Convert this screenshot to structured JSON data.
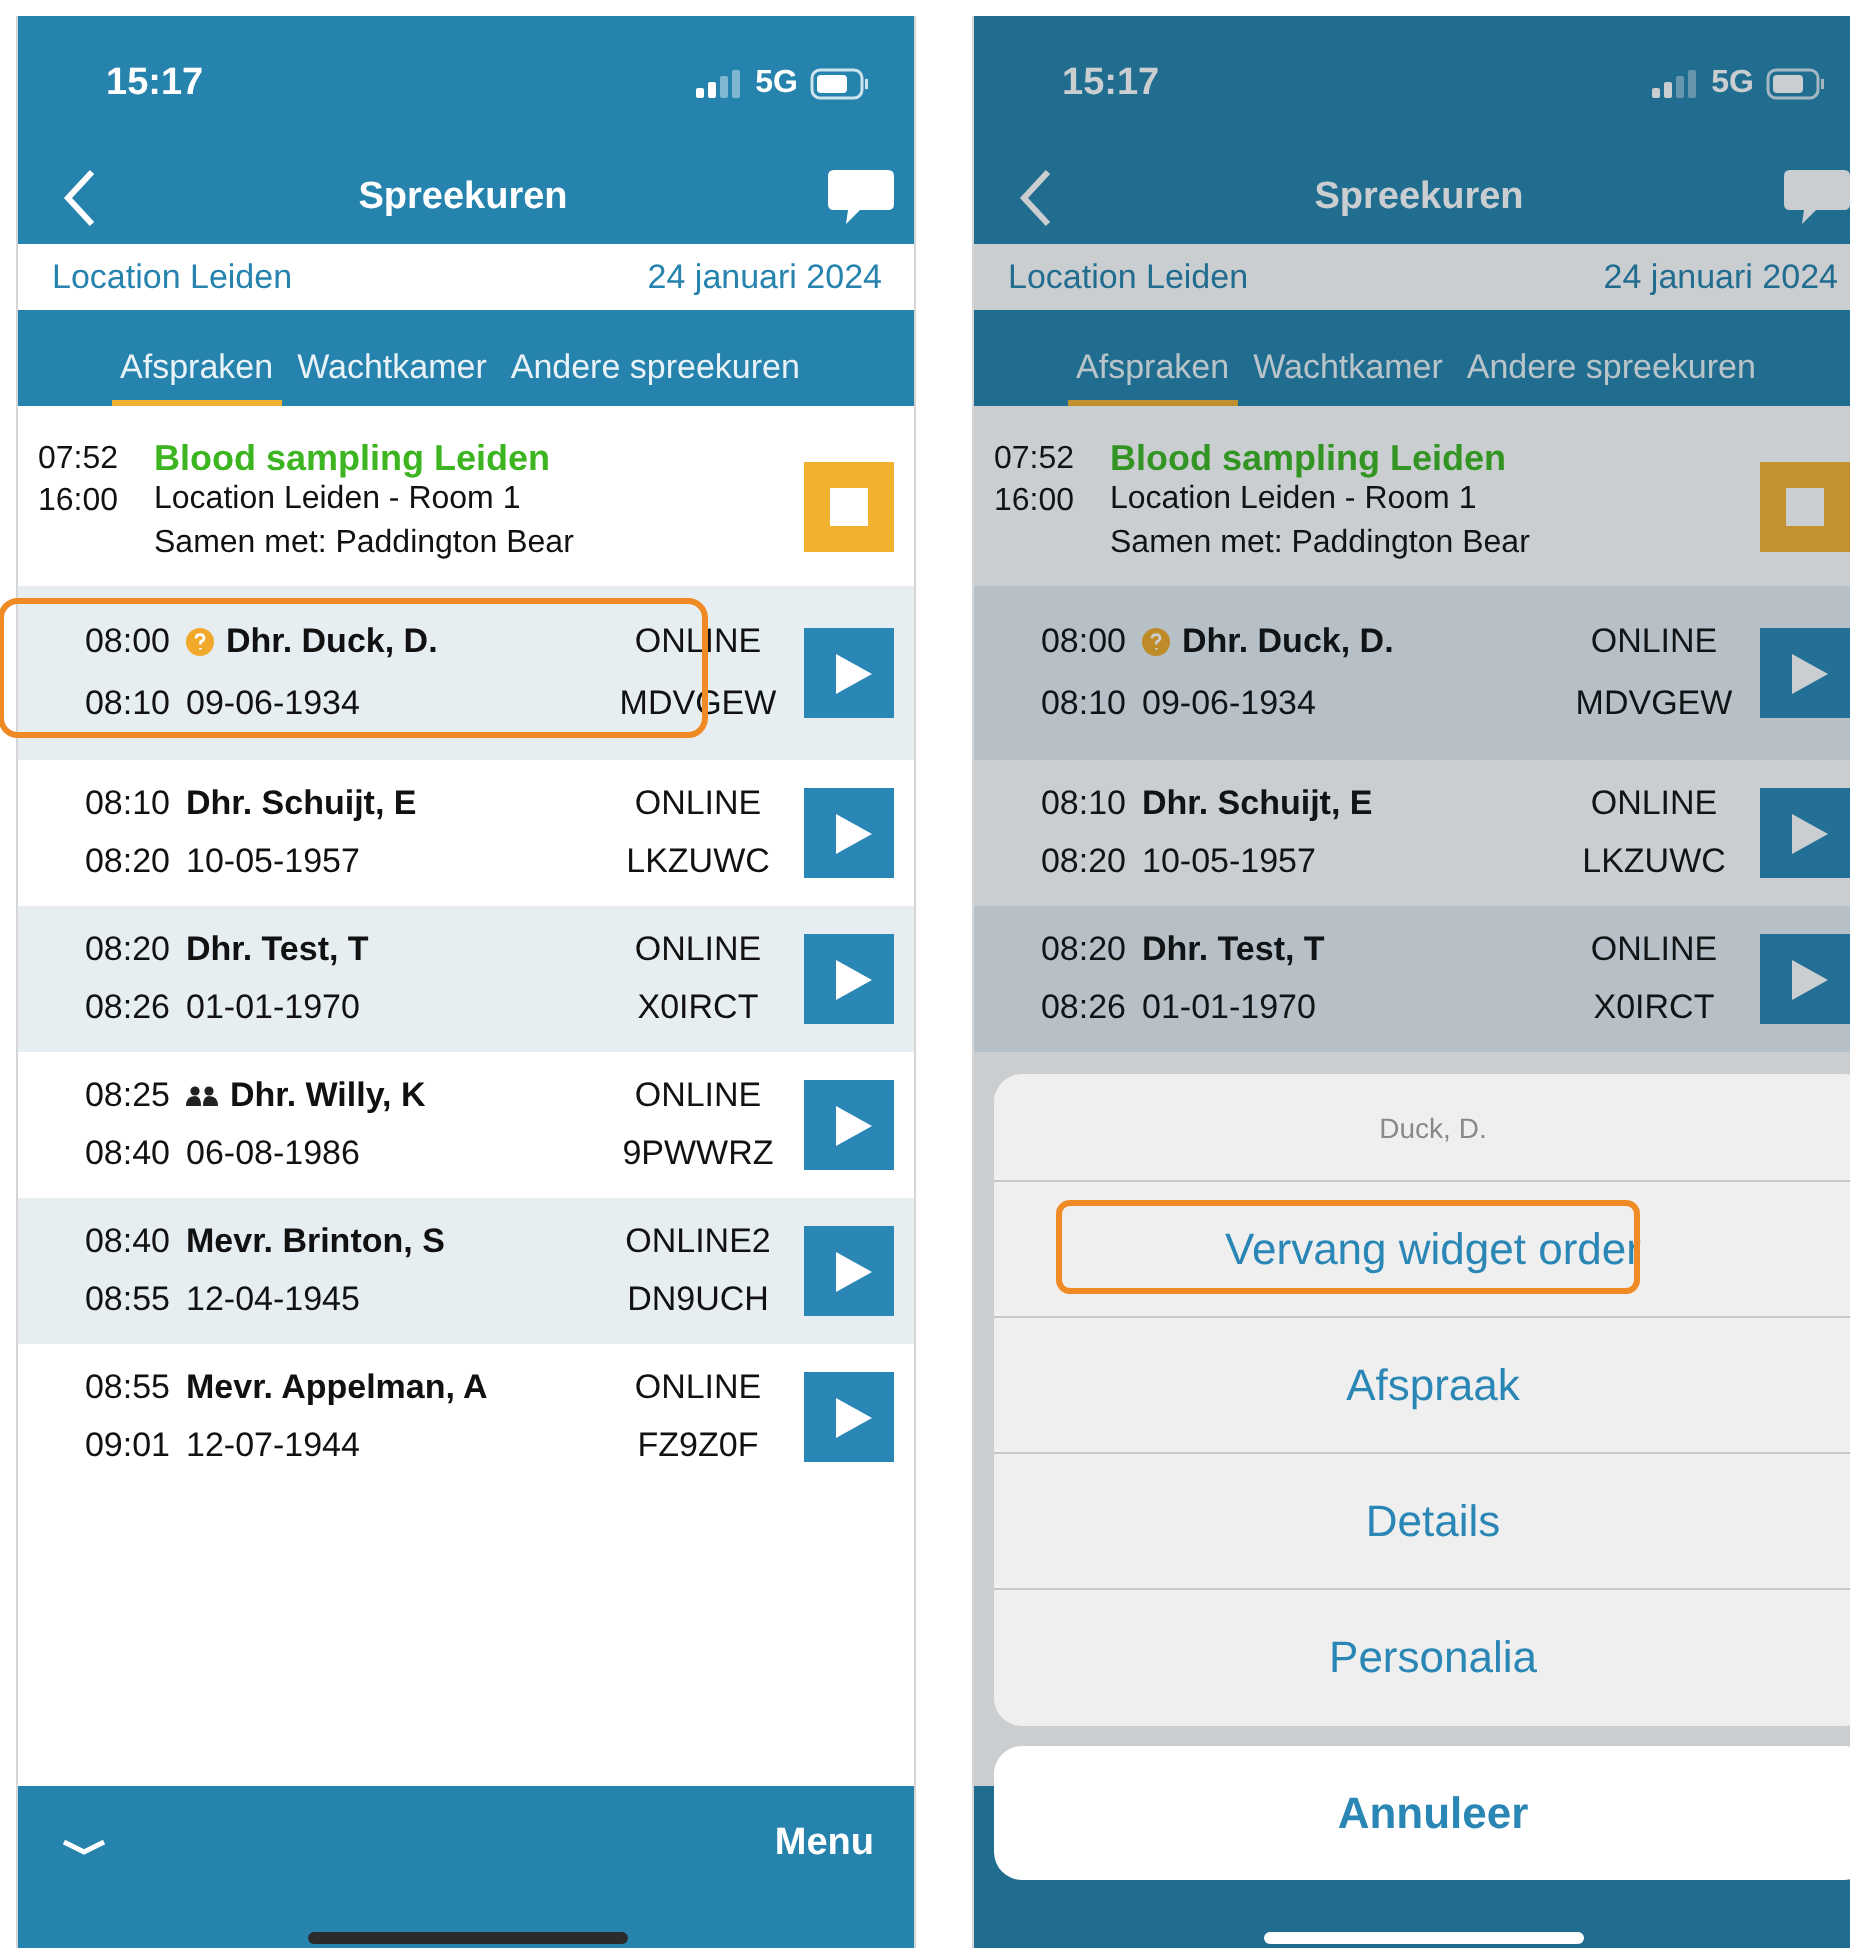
{
  "screens": [
    {
      "status": {
        "time": "15:17",
        "network": "5G"
      },
      "title": "Spreekuren",
      "location": "Location Leiden",
      "date": "24 januari 2024",
      "tabs": [
        {
          "label": "Afspraken",
          "selected": true
        },
        {
          "label": "Wachtkamer",
          "selected": false
        },
        {
          "label": "Andere spreekuren",
          "selected": false
        }
      ],
      "block": {
        "start": "07:52",
        "end": "16:00",
        "title": "Blood sampling Leiden",
        "room": "Location Leiden - Room 1",
        "with": "Samen met: Paddington Bear"
      },
      "appointments": [
        {
          "kind": "help",
          "start": "08:00",
          "end": "08:10",
          "name": "Dhr. Duck, D.",
          "dob": "09-06-1934",
          "type": "ONLINE",
          "code": "MDVGEW",
          "annotated": true
        },
        {
          "kind": "plain",
          "start": "08:10",
          "end": "08:20",
          "name": "Dhr. Schuijt, E",
          "dob": "10-05-1957",
          "type": "ONLINE",
          "code": "LKZUWC",
          "annotated": false
        },
        {
          "kind": "plain",
          "start": "08:20",
          "end": "08:26",
          "name": "Dhr. Test, T",
          "dob": "01-01-1970",
          "type": "ONLINE",
          "code": "X0IRCT",
          "annotated": false
        },
        {
          "kind": "group",
          "start": "08:25",
          "end": "08:40",
          "name": "Dhr. Willy, K",
          "dob": "06-08-1986",
          "type": "ONLINE",
          "code": "9PWWRZ",
          "annotated": false
        },
        {
          "kind": "plain",
          "start": "08:40",
          "end": "08:55",
          "name": "Mevr. Brinton, S",
          "dob": "12-04-1945",
          "type": "ONLINE2",
          "code": "DN9UCH",
          "annotated": false
        },
        {
          "kind": "plain",
          "start": "08:55",
          "end": "09:01",
          "name": "Mevr. Appelman, A",
          "dob": "12-07-1944",
          "type": "ONLINE",
          "code": "FZ9Z0F",
          "annotated": false
        }
      ],
      "bottom_bar": {
        "menu": "Menu"
      }
    },
    {
      "status": {
        "time": "15:17",
        "network": "5G"
      },
      "title": "Spreekuren",
      "location": "Location Leiden",
      "date": "24 januari 2024",
      "tabs": [
        {
          "label": "Afspraken",
          "selected": true
        },
        {
          "label": "Wachtkamer",
          "selected": false
        },
        {
          "label": "Andere spreekuren",
          "selected": false
        }
      ],
      "block": {
        "start": "07:52",
        "end": "16:00",
        "title": "Blood sampling Leiden",
        "room": "Location Leiden - Room 1",
        "with": "Samen met: Paddington Bear"
      },
      "appointments": [
        {
          "kind": "help",
          "start": "08:00",
          "end": "08:10",
          "name": "Dhr. Duck, D.",
          "dob": "09-06-1934",
          "type": "ONLINE",
          "code": "MDVGEW",
          "annotated": false
        },
        {
          "kind": "plain",
          "start": "08:10",
          "end": "08:20",
          "name": "Dhr. Schuijt, E",
          "dob": "10-05-1957",
          "type": "ONLINE",
          "code": "LKZUWC",
          "annotated": false
        },
        {
          "kind": "plain",
          "start": "08:20",
          "end": "08:26",
          "name": "Dhr. Test, T",
          "dob": "01-01-1970",
          "type": "ONLINE",
          "code": "X0IRCT",
          "annotated": false
        }
      ],
      "action_sheet": {
        "header": "Duck, D.",
        "actions": [
          {
            "label": "Vervang widget order",
            "annotated": true
          },
          {
            "label": "Afspraak",
            "annotated": false
          },
          {
            "label": "Details",
            "annotated": false
          },
          {
            "label": "Personalia",
            "annotated": false
          }
        ],
        "cancel": "Annuleer"
      }
    }
  ]
}
